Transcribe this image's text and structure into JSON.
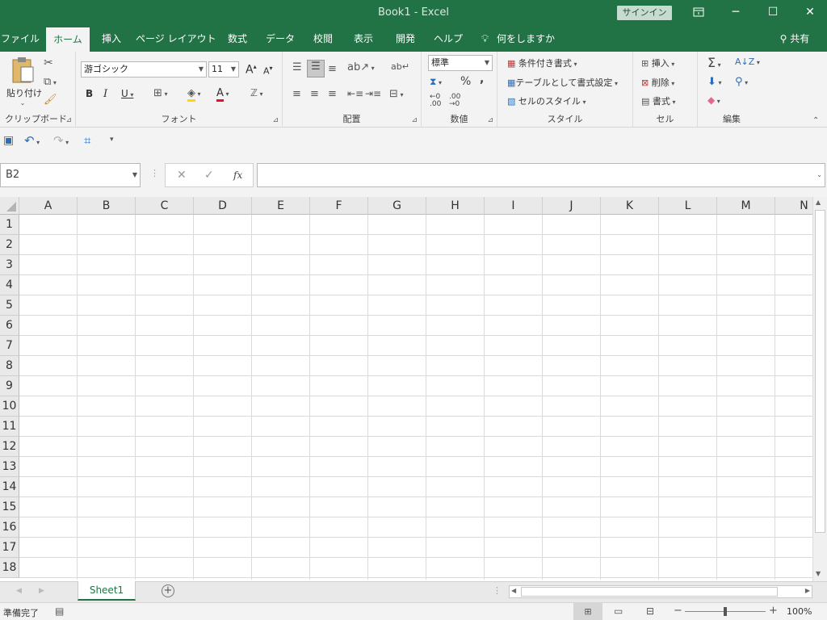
{
  "titlebar": {
    "title": "Book1  -  Excel",
    "signin": "サインイン",
    "ribbon_display_icon": "ribbon-display-icon",
    "minimize": "─",
    "maximize": "☐",
    "close": "✕"
  },
  "tabs": [
    {
      "label": "ファイル"
    },
    {
      "label": "ホーム"
    },
    {
      "label": "挿入"
    },
    {
      "label": "ページ レイアウト"
    },
    {
      "label": "数式"
    },
    {
      "label": "データ"
    },
    {
      "label": "校閲"
    },
    {
      "label": "表示"
    },
    {
      "label": "開発"
    },
    {
      "label": "ヘルプ"
    }
  ],
  "tell_me": "何をしますか",
  "share": "共有",
  "ribbon": {
    "clipboard": {
      "label": "クリップボード",
      "paste": "貼り付け"
    },
    "font": {
      "label": "フォント",
      "font_name": "游ゴシック",
      "font_size": "11",
      "bold": "B",
      "italic": "I",
      "underline": "U",
      "grow": "A",
      "shrink": "A"
    },
    "alignment": {
      "label": "配置"
    },
    "number": {
      "label": "数値",
      "format": "標準",
      "percent": "%",
      "comma": ","
    },
    "styles": {
      "label": "スタイル",
      "conditional": "条件付き書式",
      "table": "テーブルとして書式設定",
      "cell_styles": "セルのスタイル"
    },
    "cells": {
      "label": "セル",
      "insert": "挿入",
      "delete": "削除",
      "format": "書式"
    },
    "editing": {
      "label": "編集"
    }
  },
  "namebox": "B2",
  "formula": "",
  "fx": "fx",
  "columns": [
    "A",
    "B",
    "C",
    "D",
    "E",
    "F",
    "G",
    "H",
    "I",
    "J",
    "K",
    "L",
    "M",
    "N"
  ],
  "rows": [
    "1",
    "2",
    "3",
    "4",
    "5",
    "6",
    "7",
    "8",
    "9",
    "10",
    "11",
    "12",
    "13",
    "14",
    "15",
    "16",
    "17",
    "18"
  ],
  "sheet_tab": "Sheet1",
  "status": "準備完了",
  "zoom": "100%",
  "colors": {
    "accent": "#217346"
  }
}
